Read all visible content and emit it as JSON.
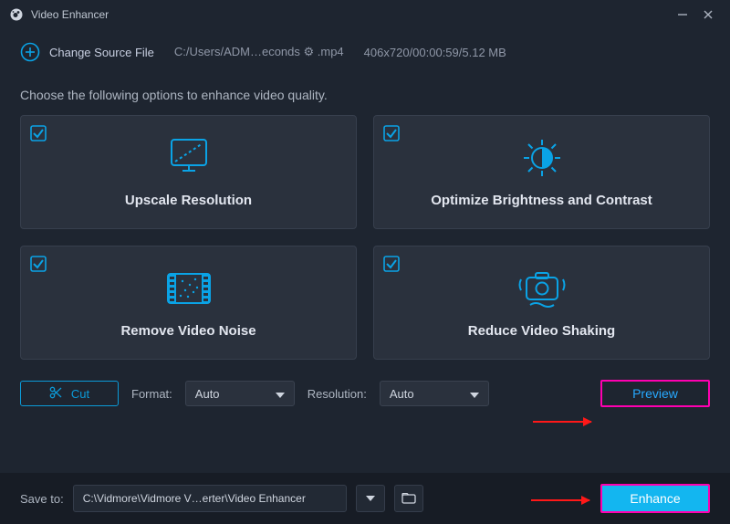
{
  "app": {
    "title": "Video Enhancer"
  },
  "source": {
    "change_label": "Change Source File",
    "path": "C:/Users/ADM…econds ⚙ .mp4",
    "meta": "406x720/00:00:59/5.12 MB"
  },
  "instruction": "Choose the following options to enhance video quality.",
  "options": [
    {
      "key": "upscale",
      "label": "Upscale Resolution",
      "checked": true
    },
    {
      "key": "brightness",
      "label": "Optimize Brightness and Contrast",
      "checked": true
    },
    {
      "key": "noise",
      "label": "Remove Video Noise",
      "checked": true
    },
    {
      "key": "shaking",
      "label": "Reduce Video Shaking",
      "checked": true
    }
  ],
  "controls": {
    "cut_label": "Cut",
    "format_label": "Format:",
    "format_value": "Auto",
    "resolution_label": "Resolution:",
    "resolution_value": "Auto",
    "preview_label": "Preview"
  },
  "footer": {
    "saveto_label": "Save to:",
    "save_path": "C:\\Vidmore\\Vidmore V…erter\\Video Enhancer",
    "enhance_label": "Enhance"
  }
}
